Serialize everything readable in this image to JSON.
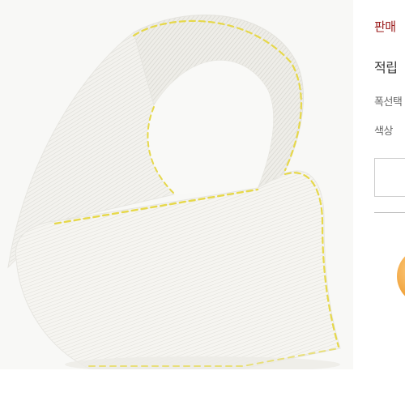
{
  "product": {
    "image_alt": "흰색 리본",
    "seller_label": "판매",
    "points_label": "적립",
    "width_label": "폭선택",
    "color_label": "색상",
    "option_select_value": ""
  },
  "colors": {
    "seller_text": "#9b1b1b",
    "ribbon": "#f5f4ef",
    "ribbon_stitch": "#e2d63a",
    "badge": "#f0a23a"
  }
}
